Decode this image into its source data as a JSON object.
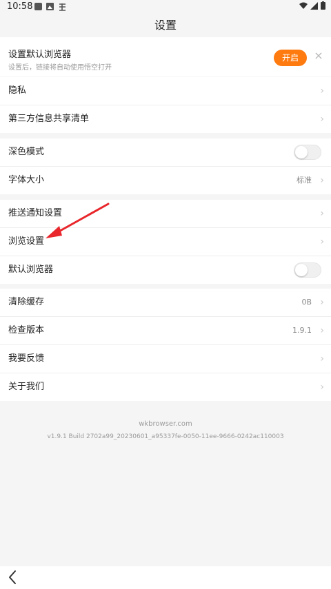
{
  "status_bar": {
    "time": "10:58",
    "notification_icons": [
      "square-icon",
      "photo-icon",
      "bug-icon"
    ],
    "system_icons": [
      "wifi-icon",
      "signal-icon",
      "battery-icon"
    ]
  },
  "header": {
    "title": "设置"
  },
  "banner": {
    "title": "设置默认浏览器",
    "subtitle": "设置后，链接将自动使用悟空打开",
    "open_label": "开启",
    "close_label": "×"
  },
  "groups": [
    {
      "rows": [
        {
          "label": "隐私",
          "type": "chevron"
        },
        {
          "label": "第三方信息共享清单",
          "type": "chevron"
        }
      ]
    },
    {
      "rows": [
        {
          "label": "深色模式",
          "type": "toggle",
          "on": false
        },
        {
          "label": "字体大小",
          "type": "value",
          "value": "标准"
        }
      ]
    },
    {
      "rows": [
        {
          "label": "推送通知设置",
          "type": "chevron"
        },
        {
          "label": "浏览设置",
          "type": "chevron"
        },
        {
          "label": "默认浏览器",
          "type": "toggle",
          "on": false
        }
      ]
    },
    {
      "rows": [
        {
          "label": "清除缓存",
          "type": "value",
          "value": "0B"
        },
        {
          "label": "检查版本",
          "type": "value",
          "value": "1.9.1"
        },
        {
          "label": "我要反馈",
          "type": "chevron"
        },
        {
          "label": "关于我们",
          "type": "chevron"
        }
      ]
    }
  ],
  "footer": {
    "site": "wkbrowser.com",
    "build": "v1.9.1 Build 2702a99_20230601_a95337fe-0050-11ee-9666-0242ac110003"
  },
  "colors": {
    "accent": "#ff7a0f",
    "annotation_arrow": "#e8262b",
    "page_bg": "#f5f5f5"
  }
}
